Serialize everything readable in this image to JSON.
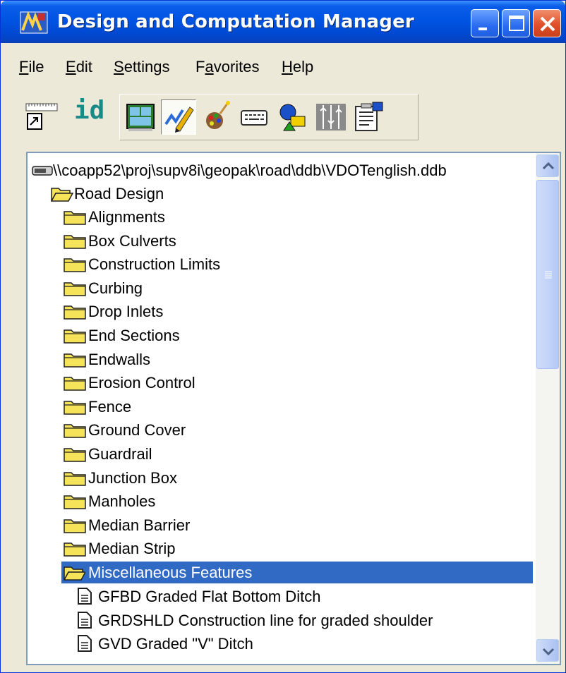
{
  "window": {
    "title": "Design and Computation Manager"
  },
  "menu": {
    "items": [
      {
        "label": "File",
        "key": "F",
        "rest": "ile"
      },
      {
        "label": "Edit",
        "key": "E",
        "rest": "dit"
      },
      {
        "label": "Settings",
        "key": "S",
        "rest": "ettings"
      },
      {
        "label": "Favorites",
        "pre": "F",
        "key": "a",
        "rest": "vorites"
      },
      {
        "label": "Help",
        "key": "H",
        "rest": "elp"
      }
    ]
  },
  "toolbar": {
    "id_label": "id",
    "icons": [
      "ruler-shortcut-icon",
      "id-icon",
      "window-panel-icon",
      "draw-pencil-icon",
      "paint-palette-icon",
      "keyboard-icon",
      "shapes-icon",
      "cross-section-icon",
      "clipboard-settings-icon"
    ]
  },
  "tree": {
    "root_path": "\\\\coapp52\\proj\\supv8i\\geopak\\road\\ddb\\VDOTenglish.ddb",
    "category": "Road Design",
    "folders": [
      "Alignments",
      "Box Culverts",
      "Construction Limits",
      "Curbing",
      "Drop Inlets",
      "End Sections",
      "Endwalls",
      "Erosion Control",
      "Fence",
      "Ground Cover",
      "Guardrail",
      "Junction Box",
      "Manholes",
      "Median Barrier",
      "Median Strip"
    ],
    "selected_folder": "Miscellaneous Features",
    "items": [
      "GFBD Graded Flat Bottom Ditch",
      "GRDSHLD Construction line for graded shoulder",
      "GVD Graded \"V\" Ditch"
    ]
  },
  "colors": {
    "title_bar": "#0054e3",
    "selection": "#316ac5",
    "folder": "#f5e35a"
  }
}
